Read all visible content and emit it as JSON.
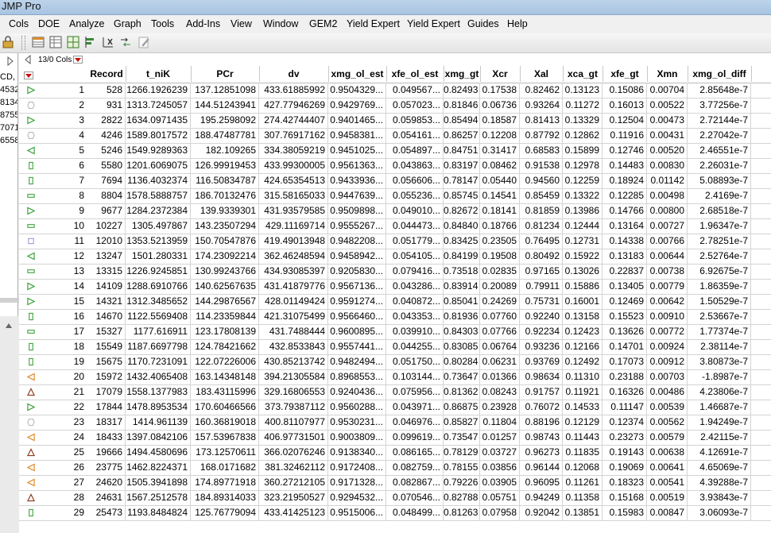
{
  "window": {
    "title": "JMP Pro"
  },
  "menu": [
    "Cols",
    "DOE",
    "Analyze",
    "Graph",
    "Tools",
    "Add-Ins",
    "View",
    "Window",
    "GEM2",
    "Yield Expert",
    "Yield Expert",
    "Guides",
    "Help"
  ],
  "toolbar": {
    "icons": [
      "table-icon",
      "data-grid-icon",
      "col-grid-icon",
      "align-icon",
      "x-axis-icon",
      "arrow-route-icon",
      "edit-pencil-icon"
    ]
  },
  "left_panel": {
    "items": [
      "CD,",
      "4532",
      "8134",
      "8755",
      "7071",
      "6558"
    ]
  },
  "table": {
    "cols_info": "13/0 Cols",
    "columns": [
      "Record",
      "t_niK",
      "PCr",
      "dv",
      "xmg_ol_est",
      "xfe_ol_est",
      "xmg_gt",
      "Xcr",
      "Xal",
      "xca_gt",
      "xfe_gt",
      "Xmn",
      "xmg_ol_diff"
    ],
    "rows": [
      {
        "n": "1",
        "m": "tri-right",
        "c": [
          "528",
          "1266.1926239",
          "137.12851098",
          "433.61885992",
          "0.9504329...",
          "0.049567...",
          "0.82493",
          "0.17538",
          "0.82462",
          "0.13123",
          "0.15086",
          "0.00704",
          "2.85648e-7"
        ]
      },
      {
        "n": "2",
        "m": "hexagon",
        "c": [
          "931",
          "1313.7245057",
          "144.51243941",
          "427.77946269",
          "0.9429769...",
          "0.057023...",
          "0.81846",
          "0.06736",
          "0.93264",
          "0.11272",
          "0.16013",
          "0.00522",
          "3.77256e-7"
        ]
      },
      {
        "n": "3",
        "m": "tri-right",
        "c": [
          "2822",
          "1634.0971435",
          "195.2598092",
          "274.42744407",
          "0.9401465...",
          "0.059853...",
          "0.85494",
          "0.18587",
          "0.81413",
          "0.13329",
          "0.12504",
          "0.00473",
          "2.72144e-7"
        ]
      },
      {
        "n": "4",
        "m": "hexagon",
        "c": [
          "4246",
          "1589.8017572",
          "188.47487781",
          "307.76917162",
          "0.9458381...",
          "0.054161...",
          "0.86257",
          "0.12208",
          "0.87792",
          "0.12862",
          "0.11916",
          "0.00431",
          "2.27042e-7"
        ]
      },
      {
        "n": "5",
        "m": "tri-left",
        "c": [
          "5246",
          "1549.9289363",
          "182.109265",
          "334.38059219",
          "0.9451025...",
          "0.054897...",
          "0.84751",
          "0.31417",
          "0.68583",
          "0.15899",
          "0.12746",
          "0.00520",
          "2.46551e-7"
        ]
      },
      {
        "n": "6",
        "m": "rect-tall",
        "c": [
          "5580",
          "1201.6069075",
          "126.99919453",
          "433.99300005",
          "0.9561363...",
          "0.043863...",
          "0.83197",
          "0.08462",
          "0.91538",
          "0.12978",
          "0.14483",
          "0.00830",
          "2.26031e-7"
        ]
      },
      {
        "n": "7",
        "m": "rect-tall",
        "c": [
          "7694",
          "1136.4032374",
          "116.50834787",
          "424.65354513",
          "0.9433936...",
          "0.056606...",
          "0.78147",
          "0.05440",
          "0.94560",
          "0.12259",
          "0.18924",
          "0.01142",
          "5.08893e-7"
        ]
      },
      {
        "n": "8",
        "m": "rect-wide",
        "c": [
          "8804",
          "1578.5888757",
          "186.70132476",
          "315.58165033",
          "0.9447639...",
          "0.055236...",
          "0.85745",
          "0.14541",
          "0.85459",
          "0.13322",
          "0.12285",
          "0.00498",
          "2.4169e-7"
        ]
      },
      {
        "n": "9",
        "m": "tri-right",
        "c": [
          "9677",
          "1284.2372384",
          "139.9339301",
          "431.93579585",
          "0.9509898...",
          "0.049010...",
          "0.82672",
          "0.18141",
          "0.81859",
          "0.13986",
          "0.14766",
          "0.00800",
          "2.68518e-7"
        ]
      },
      {
        "n": "10",
        "m": "rect-wide",
        "c": [
          "10227",
          "1305.497867",
          "143.23507294",
          "429.11169714",
          "0.9555267...",
          "0.044473...",
          "0.84840",
          "0.18766",
          "0.81234",
          "0.12444",
          "0.13164",
          "0.00727",
          "1.96347e-7"
        ]
      },
      {
        "n": "11",
        "m": "square",
        "c": [
          "12010",
          "1353.5213959",
          "150.70547876",
          "419.49013948",
          "0.9482208...",
          "0.051779...",
          "0.83425",
          "0.23505",
          "0.76495",
          "0.12731",
          "0.14338",
          "0.00766",
          "2.78251e-7"
        ]
      },
      {
        "n": "12",
        "m": "tri-left",
        "c": [
          "13247",
          "1501.280331",
          "174.23092214",
          "362.46248594",
          "0.9458942...",
          "0.054105...",
          "0.84199",
          "0.19508",
          "0.80492",
          "0.15922",
          "0.13183",
          "0.00644",
          "2.52764e-7"
        ]
      },
      {
        "n": "13",
        "m": "rect-wide",
        "c": [
          "13315",
          "1226.9245851",
          "130.99243766",
          "434.93085397",
          "0.9205830...",
          "0.079416...",
          "0.73518",
          "0.02835",
          "0.97165",
          "0.13026",
          "0.22837",
          "0.00738",
          "6.92675e-7"
        ]
      },
      {
        "n": "14",
        "m": "tri-right",
        "c": [
          "14109",
          "1288.6910766",
          "140.62567635",
          "431.41879776",
          "0.9567136...",
          "0.043286...",
          "0.83914",
          "0.20089",
          "0.79911",
          "0.15886",
          "0.13405",
          "0.00779",
          "1.86359e-7"
        ]
      },
      {
        "n": "15",
        "m": "tri-right",
        "c": [
          "14321",
          "1312.3485652",
          "144.29876567",
          "428.01149424",
          "0.9591274...",
          "0.040872...",
          "0.85041",
          "0.24269",
          "0.75731",
          "0.16001",
          "0.12469",
          "0.00642",
          "1.50529e-7"
        ]
      },
      {
        "n": "16",
        "m": "rect-tall",
        "c": [
          "14670",
          "1122.5569408",
          "114.23359844",
          "421.31075499",
          "0.9566460...",
          "0.043353...",
          "0.81936",
          "0.07760",
          "0.92240",
          "0.13158",
          "0.15523",
          "0.00910",
          "2.53667e-7"
        ]
      },
      {
        "n": "17",
        "m": "rect-wide",
        "c": [
          "15327",
          "1177.616911",
          "123.17808139",
          "431.7488444",
          "0.9600895...",
          "0.039910...",
          "0.84303",
          "0.07766",
          "0.92234",
          "0.12423",
          "0.13626",
          "0.00772",
          "1.77374e-7"
        ]
      },
      {
        "n": "18",
        "m": "rect-tall",
        "c": [
          "15549",
          "1187.6697798",
          "124.78421662",
          "432.8533843",
          "0.9557441...",
          "0.044255...",
          "0.83085",
          "0.06764",
          "0.93236",
          "0.12166",
          "0.14701",
          "0.00924",
          "2.38114e-7"
        ]
      },
      {
        "n": "19",
        "m": "rect-tall",
        "c": [
          "15675",
          "1170.7231091",
          "122.07226006",
          "430.85213742",
          "0.9482494...",
          "0.051750...",
          "0.80284",
          "0.06231",
          "0.93769",
          "0.12492",
          "0.17073",
          "0.00912",
          "3.80873e-7"
        ]
      },
      {
        "n": "20",
        "m": "tri-left-orange",
        "c": [
          "15972",
          "1432.4065408",
          "163.14348148",
          "394.21305584",
          "0.8968553...",
          "0.103144...",
          "0.73647",
          "0.01366",
          "0.98634",
          "0.11310",
          "0.23188",
          "0.00703",
          "-1.8987e-7"
        ]
      },
      {
        "n": "21",
        "m": "tri-up",
        "c": [
          "17079",
          "1558.1377983",
          "183.43115996",
          "329.16806553",
          "0.9240436...",
          "0.075956...",
          "0.81362",
          "0.08243",
          "0.91757",
          "0.11921",
          "0.16326",
          "0.00486",
          "4.23806e-7"
        ]
      },
      {
        "n": "22",
        "m": "tri-right",
        "c": [
          "17844",
          "1478.8953534",
          "170.60466566",
          "373.79387112",
          "0.9560288...",
          "0.043971...",
          "0.86875",
          "0.23928",
          "0.76072",
          "0.14533",
          "0.11147",
          "0.00539",
          "1.46687e-7"
        ]
      },
      {
        "n": "23",
        "m": "hexagon",
        "c": [
          "18317",
          "1414.961139",
          "160.36819018",
          "400.81107977",
          "0.9530231...",
          "0.046976...",
          "0.85827",
          "0.11804",
          "0.88196",
          "0.12129",
          "0.12374",
          "0.00562",
          "1.94249e-7"
        ]
      },
      {
        "n": "24",
        "m": "tri-left-orange",
        "c": [
          "18433",
          "1397.0842106",
          "157.53967838",
          "406.97731501",
          "0.9003809...",
          "0.099619...",
          "0.73547",
          "0.01257",
          "0.98743",
          "0.11443",
          "0.23273",
          "0.00579",
          "2.42115e-7"
        ]
      },
      {
        "n": "25",
        "m": "tri-up",
        "c": [
          "19666",
          "1494.4580696",
          "173.12570611",
          "366.02076246",
          "0.9138340...",
          "0.086165...",
          "0.78129",
          "0.03727",
          "0.96273",
          "0.11835",
          "0.19143",
          "0.00638",
          "4.12691e-7"
        ]
      },
      {
        "n": "26",
        "m": "tri-left-orange",
        "c": [
          "23775",
          "1462.8224371",
          "168.0171682",
          "381.32462112",
          "0.9172408...",
          "0.082759...",
          "0.78155",
          "0.03856",
          "0.96144",
          "0.12068",
          "0.19069",
          "0.00641",
          "4.65069e-7"
        ]
      },
      {
        "n": "27",
        "m": "tri-left-orange",
        "c": [
          "24620",
          "1505.3941898",
          "174.89771918",
          "360.27212105",
          "0.9171328...",
          "0.082867...",
          "0.79226",
          "0.03905",
          "0.96095",
          "0.11261",
          "0.18323",
          "0.00541",
          "4.39288e-7"
        ]
      },
      {
        "n": "28",
        "m": "tri-up",
        "c": [
          "24631",
          "1567.2512578",
          "184.89314033",
          "323.21950527",
          "0.9294532...",
          "0.070546...",
          "0.82788",
          "0.05751",
          "0.94249",
          "0.11358",
          "0.15168",
          "0.00519",
          "3.93843e-7"
        ]
      },
      {
        "n": "29",
        "m": "rect-tall",
        "c": [
          "25473",
          "1193.8484824",
          "125.76779094",
          "433.41425123",
          "0.9515006...",
          "0.048499...",
          "0.81263",
          "0.07958",
          "0.92042",
          "0.13851",
          "0.15983",
          "0.00847",
          "3.06093e-7"
        ]
      }
    ]
  },
  "colors": {
    "marker_green": "#3aa23a",
    "marker_orange": "#e08a2a",
    "marker_brown": "#8b3a1a",
    "marker_red": "#cc1111"
  }
}
